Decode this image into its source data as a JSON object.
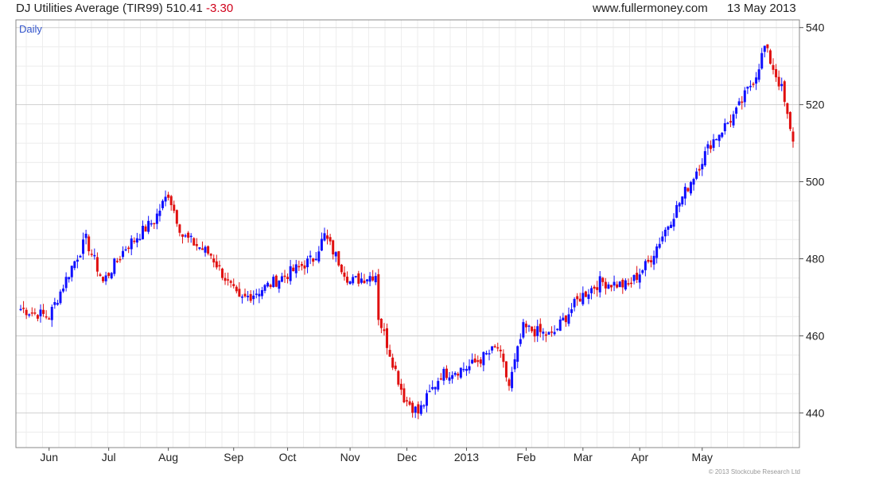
{
  "header": {
    "title": "DJ Utilities Average (TIR99) 510.41",
    "change": "-3.30",
    "site": "www.fullermoney.com",
    "date": "13 May 2013"
  },
  "colors": {
    "up": "#1010ff",
    "down": "#e01010",
    "grid": "#dedede",
    "change": "#d0021b",
    "period": "#3355cc"
  },
  "footer": {
    "copyright": "© 2013 Stockcube Research Ltd"
  },
  "chart_data": {
    "type": "ohlc",
    "period_label": "Daily",
    "ylim": [
      431,
      542
    ],
    "yticks": [
      440,
      460,
      480,
      500,
      520,
      540
    ],
    "month_labels": [
      "Jun",
      "Jul",
      "Aug",
      "Sep",
      "Oct",
      "Nov",
      "Dec",
      "2013",
      "Feb",
      "Mar",
      "Apr",
      "May"
    ],
    "grid": true,
    "start_value": 467,
    "anchors": [
      [
        0,
        467
      ],
      [
        10,
        465
      ],
      [
        18,
        478
      ],
      [
        23,
        485
      ],
      [
        29,
        474
      ],
      [
        37,
        483
      ],
      [
        47,
        490
      ],
      [
        52,
        497
      ],
      [
        57,
        486
      ],
      [
        67,
        481
      ],
      [
        77,
        469
      ],
      [
        87,
        473
      ],
      [
        103,
        480
      ],
      [
        107,
        486
      ],
      [
        116,
        474
      ],
      [
        125,
        476
      ],
      [
        126,
        465
      ],
      [
        135,
        444
      ],
      [
        140,
        440
      ],
      [
        148,
        450
      ],
      [
        158,
        452
      ],
      [
        168,
        457
      ],
      [
        172,
        447
      ],
      [
        177,
        462
      ],
      [
        187,
        460
      ],
      [
        197,
        470
      ],
      [
        204,
        474
      ],
      [
        214,
        473
      ],
      [
        221,
        479
      ],
      [
        233,
        496
      ],
      [
        243,
        510
      ],
      [
        252,
        518
      ],
      [
        259,
        528
      ],
      [
        262,
        535
      ],
      [
        268,
        524
      ],
      [
        271,
        513
      ],
      [
        272,
        510.41
      ]
    ]
  }
}
